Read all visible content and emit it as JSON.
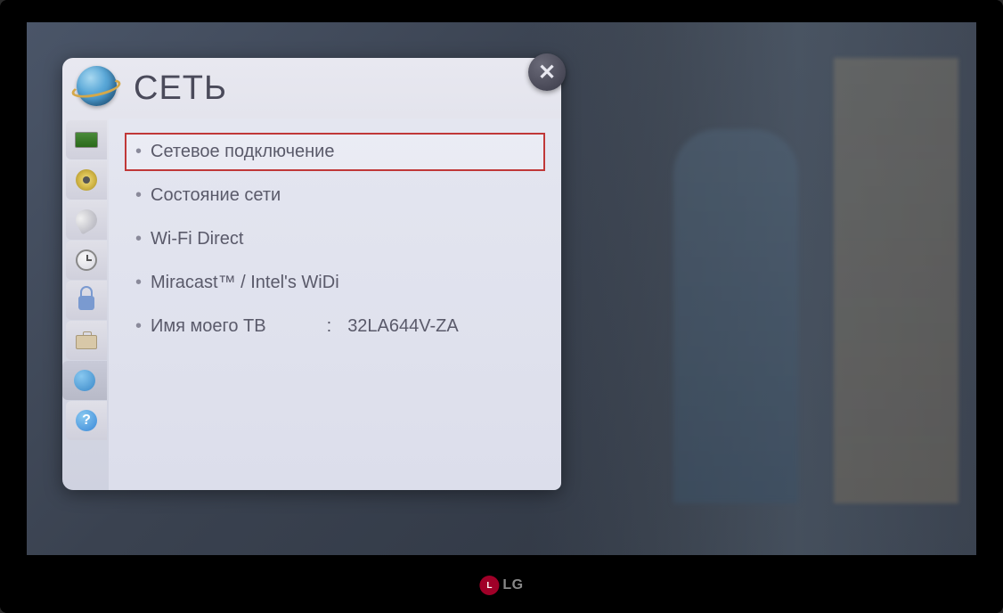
{
  "header": {
    "title": "СЕТЬ"
  },
  "menu": {
    "items": [
      {
        "label": "Сетевое подключение",
        "selected": true
      },
      {
        "label": "Состояние сети",
        "selected": false
      },
      {
        "label": "Wi-Fi Direct",
        "selected": false
      },
      {
        "label": "Miracast™ / Intel's WiDi",
        "selected": false
      },
      {
        "label": "Имя моего ТВ",
        "value": "32LA644V-ZA",
        "selected": false
      }
    ]
  },
  "help_glyph": "?",
  "logo": {
    "brand": "LG"
  }
}
